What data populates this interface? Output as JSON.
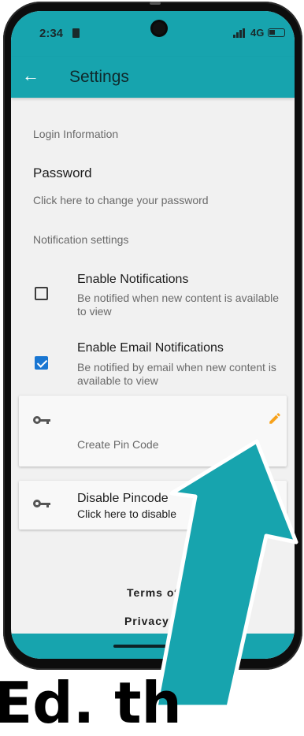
{
  "status": {
    "time": "2:34",
    "network": "4G"
  },
  "appbar": {
    "title": "Settings",
    "back_icon": "arrow-left-icon"
  },
  "login": {
    "section_label": "Login Information",
    "password_title": "Password",
    "password_subtitle": "Click here to change your password"
  },
  "notifications": {
    "section_label": "Notification settings",
    "items": [
      {
        "title": "Enable Notifications",
        "subtitle": "Be notified when new content is available to view",
        "checked": false
      },
      {
        "title": "Enable Email Notifications",
        "subtitle": "Be notified by email when new content is available to view",
        "checked": true
      }
    ]
  },
  "pincode": {
    "create_label": "Create Pin Code",
    "disable_title": "Disable Pincode",
    "disable_subtitle": "Click here to disable",
    "edit_icon": "pencil-icon",
    "key_icon": "key-icon"
  },
  "footer": {
    "terms": "Terms of",
    "privacy": "Privacy S"
  },
  "overlay": {
    "bottom_text": "Ed. th"
  },
  "colors": {
    "primary": "#17a4ae",
    "accent": "#f7a21b",
    "checkbox": "#1976d2"
  }
}
